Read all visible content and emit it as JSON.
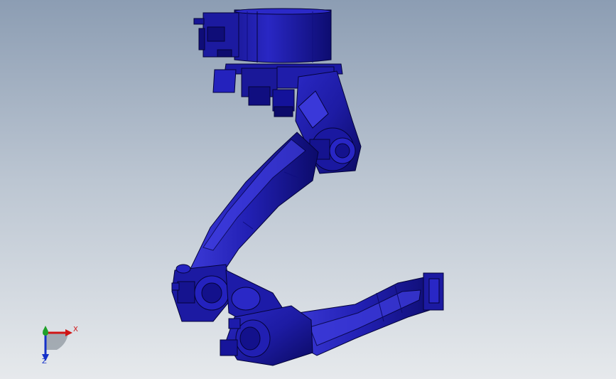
{
  "viewport": {
    "background_top": "#8c9db3",
    "background_bottom": "#e6e9ec",
    "model_color": "#1e1c9e",
    "model_highlight": "#3535d8",
    "model_shadow": "#06054d"
  },
  "triad": {
    "x_label": "X",
    "z_label": "Z",
    "x_color": "#d01515",
    "y_color": "#1fa02a",
    "z_color": "#1531c9"
  }
}
